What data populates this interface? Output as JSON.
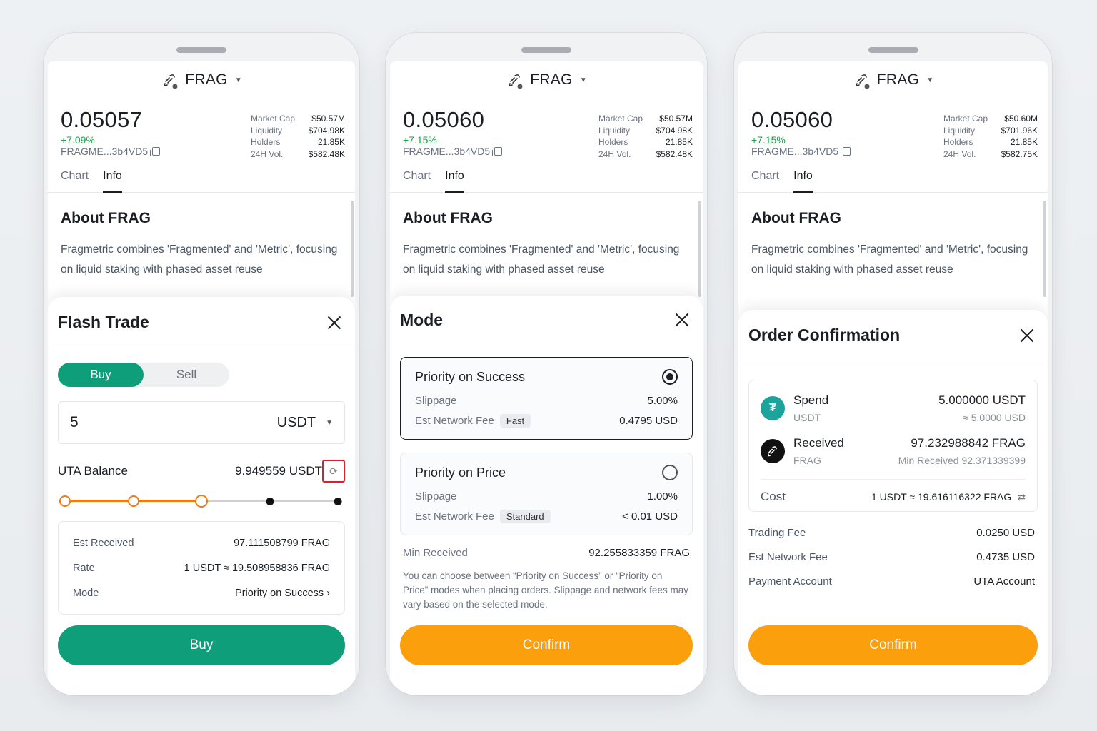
{
  "phones": [
    {
      "header": {
        "token": "FRAG"
      },
      "price": "0.05057",
      "change": "+7.09%",
      "address": "FRAGME...3b4VD5",
      "stats": [
        {
          "k": "Market Cap",
          "v": "$50.57M"
        },
        {
          "k": "Liquidity",
          "v": "$704.98K"
        },
        {
          "k": "Holders",
          "v": "21.85K"
        },
        {
          "k": "24H Vol.",
          "v": "$582.48K"
        }
      ],
      "tabs": [
        "Chart",
        "Info"
      ],
      "about_title": "About FRAG",
      "about_text": "Fragmetric combines 'Fragmented' and 'Metric', focusing on liquid staking with phased asset reuse"
    },
    {
      "header": {
        "token": "FRAG"
      },
      "price": "0.05060",
      "change": "+7.15%",
      "address": "FRAGME...3b4VD5",
      "stats": [
        {
          "k": "Market Cap",
          "v": "$50.57M"
        },
        {
          "k": "Liquidity",
          "v": "$704.98K"
        },
        {
          "k": "Holders",
          "v": "21.85K"
        },
        {
          "k": "24H Vol.",
          "v": "$582.48K"
        }
      ],
      "tabs": [
        "Chart",
        "Info"
      ],
      "about_title": "About FRAG",
      "about_text": "Fragmetric combines 'Fragmented' and 'Metric', focusing on liquid staking with phased asset reuse"
    },
    {
      "header": {
        "token": "FRAG"
      },
      "price": "0.05060",
      "change": "+7.15%",
      "address": "FRAGME...3b4VD5",
      "stats": [
        {
          "k": "Market Cap",
          "v": "$50.60M"
        },
        {
          "k": "Liquidity",
          "v": "$701.96K"
        },
        {
          "k": "Holders",
          "v": "21.85K"
        },
        {
          "k": "24H Vol.",
          "v": "$582.75K"
        }
      ],
      "tabs": [
        "Chart",
        "Info"
      ],
      "about_title": "About FRAG",
      "about_text": "Fragmetric combines 'Fragmented' and 'Metric', focusing on liquid staking with phased asset reuse"
    }
  ],
  "flash": {
    "title": "Flash Trade",
    "buy_tab": "Buy",
    "sell_tab": "Sell",
    "amount": "5",
    "currency": "USDT",
    "balance_label": "UTA Balance",
    "balance_value": "9.949559 USDT",
    "slider_level": 0.5,
    "est_received_label": "Est Received",
    "est_received_value": "97.111508799 FRAG",
    "rate_label": "Rate",
    "rate_value": "1 USDT ≈ 19.508958836 FRAG",
    "mode_label": "Mode",
    "mode_value": "Priority on Success ›",
    "buy_button": "Buy"
  },
  "mode": {
    "title": "Mode",
    "options": [
      {
        "name": "Priority on Success",
        "slippage_label": "Slippage",
        "slippage": "5.00%",
        "fee_label": "Est Network Fee",
        "chip": "Fast",
        "fee": "0.4795 USD",
        "selected": true
      },
      {
        "name": "Priority on Price",
        "slippage_label": "Slippage",
        "slippage": "1.00%",
        "fee_label": "Est Network Fee",
        "chip": "Standard",
        "fee": "< 0.01 USD",
        "selected": false
      }
    ],
    "min_received_label": "Min Received",
    "min_received_value": "92.255833359 FRAG",
    "note": "You can choose between “Priority on Success” or “Priority on Price” modes when placing orders. Slippage and network fees may vary based on the selected mode.",
    "confirm": "Confirm"
  },
  "order": {
    "title": "Order Confirmation",
    "spend_label": "Spend",
    "spend_sub": "USDT",
    "spend_value": "5.000000 USDT",
    "spend_approx": "≈ 5.0000 USD",
    "received_label": "Received",
    "received_sub": "FRAG",
    "received_value": "97.232988842 FRAG",
    "min_received": "Min Received 92.371339399",
    "cost_label": "Cost",
    "cost_value": "1 USDT ≈ 19.616116322 FRAG",
    "trading_fee_label": "Trading Fee",
    "trading_fee": "0.0250 USD",
    "network_fee_label": "Est Network Fee",
    "network_fee": "0.4735 USD",
    "payment_label": "Payment Account",
    "payment_value": "UTA Account",
    "confirm": "Confirm"
  },
  "colors": {
    "green": "#0e9f7a",
    "orange": "#fc9f0d",
    "slider": "#f07b16"
  }
}
